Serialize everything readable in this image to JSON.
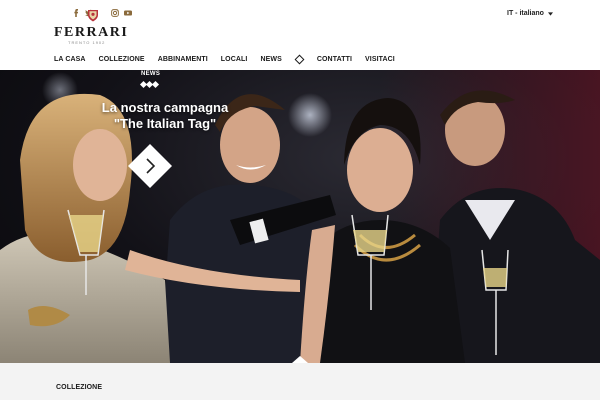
{
  "brand": {
    "name": "FERRARI",
    "tagline": "TRENTO 1902"
  },
  "socials": [
    "facebook-icon",
    "twitter-icon",
    "instagram-icon",
    "youtube-icon"
  ],
  "language": {
    "label": "IT - italiano"
  },
  "nav": {
    "items": [
      "LA CASA",
      "COLLEZIONE",
      "ABBINAMENTI",
      "LOCALI",
      "NEWS"
    ],
    "after_diamond": [
      "CONTATTI",
      "VISITACI"
    ]
  },
  "hero": {
    "category": "NEWS",
    "title_line1": "La nostra campagna",
    "title_line2": "\"The Italian Tag\""
  },
  "section": {
    "label": "COLLEZIONE"
  },
  "colors": {
    "accent_dark": "#121117",
    "section_bg": "#f3f3f3"
  }
}
